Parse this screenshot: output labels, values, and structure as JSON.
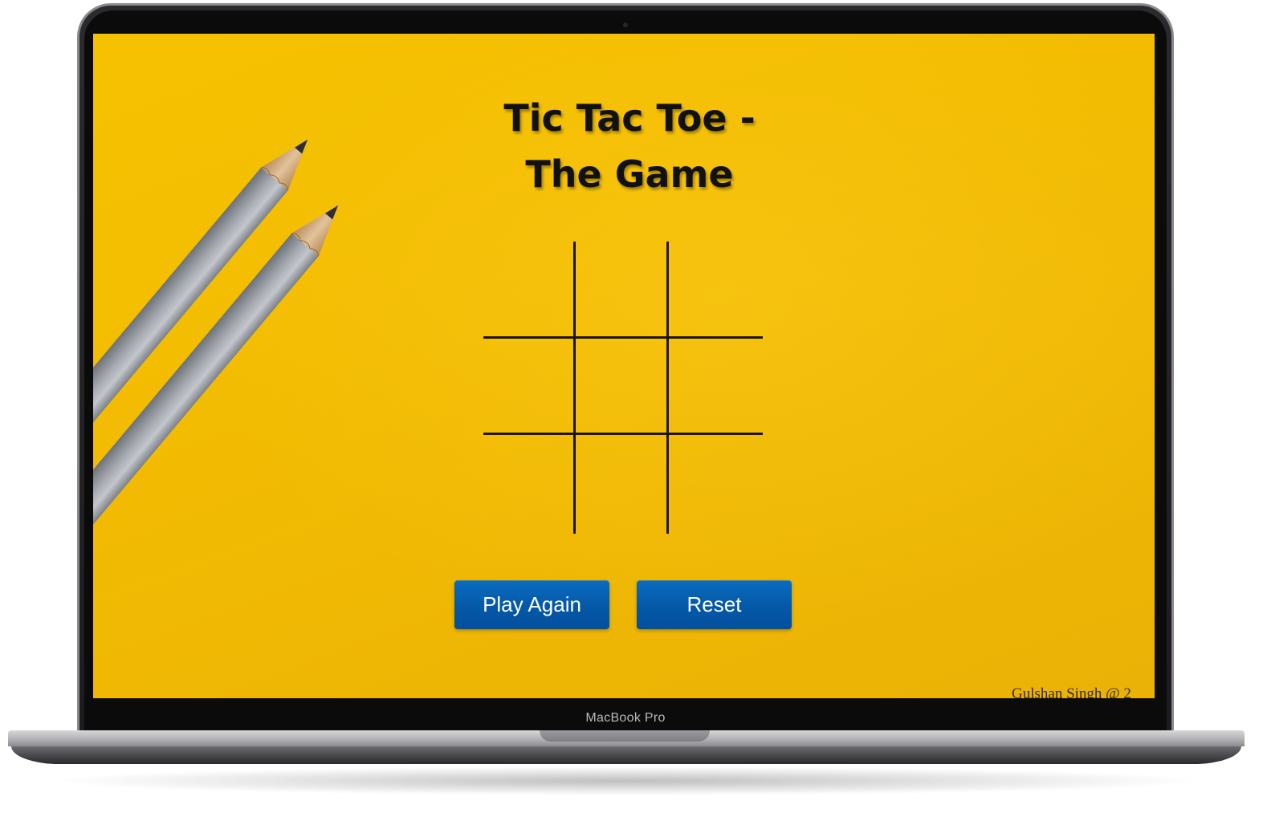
{
  "device": {
    "brand_label": "MacBook Pro"
  },
  "game": {
    "title_line1": "Tic Tac Toe -",
    "title_line2": "The Game",
    "board": [
      "",
      "",
      "",
      "",
      "",
      "",
      "",
      "",
      ""
    ],
    "buttons": {
      "play_again": "Play Again",
      "reset": "Reset"
    },
    "footer": "Gulshan Singh @ 2"
  },
  "colors": {
    "background": "#f4bf02",
    "grid_line": "#1b1406",
    "button": "#0458a6",
    "button_text": "#ffffff"
  }
}
